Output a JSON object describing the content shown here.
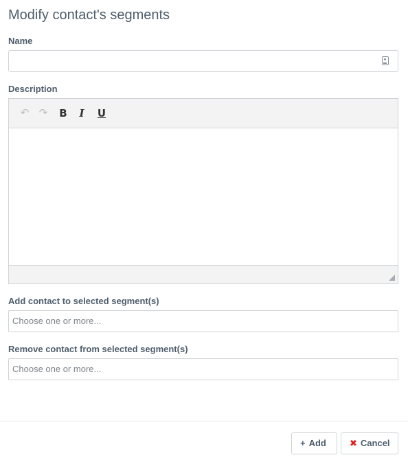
{
  "modal": {
    "title": "Modify contact's segments"
  },
  "form": {
    "name": {
      "label": "Name",
      "value": "",
      "icon": "id-badge-icon"
    },
    "description": {
      "label": "Description",
      "toolbar": {
        "undo_icon": "↶",
        "redo_icon": "↷",
        "bold": "B",
        "italic": "I",
        "underline": "U"
      }
    },
    "add_segments": {
      "label": "Add contact to selected segment(s)",
      "placeholder": "Choose one or more..."
    },
    "remove_segments": {
      "label": "Remove contact from selected segment(s)",
      "placeholder": "Choose one or more..."
    }
  },
  "footer": {
    "add_icon": "+",
    "add_label": "Add",
    "cancel_icon": "✖",
    "cancel_label": "Cancel",
    "cancel_icon_color": "#e01b1b"
  }
}
